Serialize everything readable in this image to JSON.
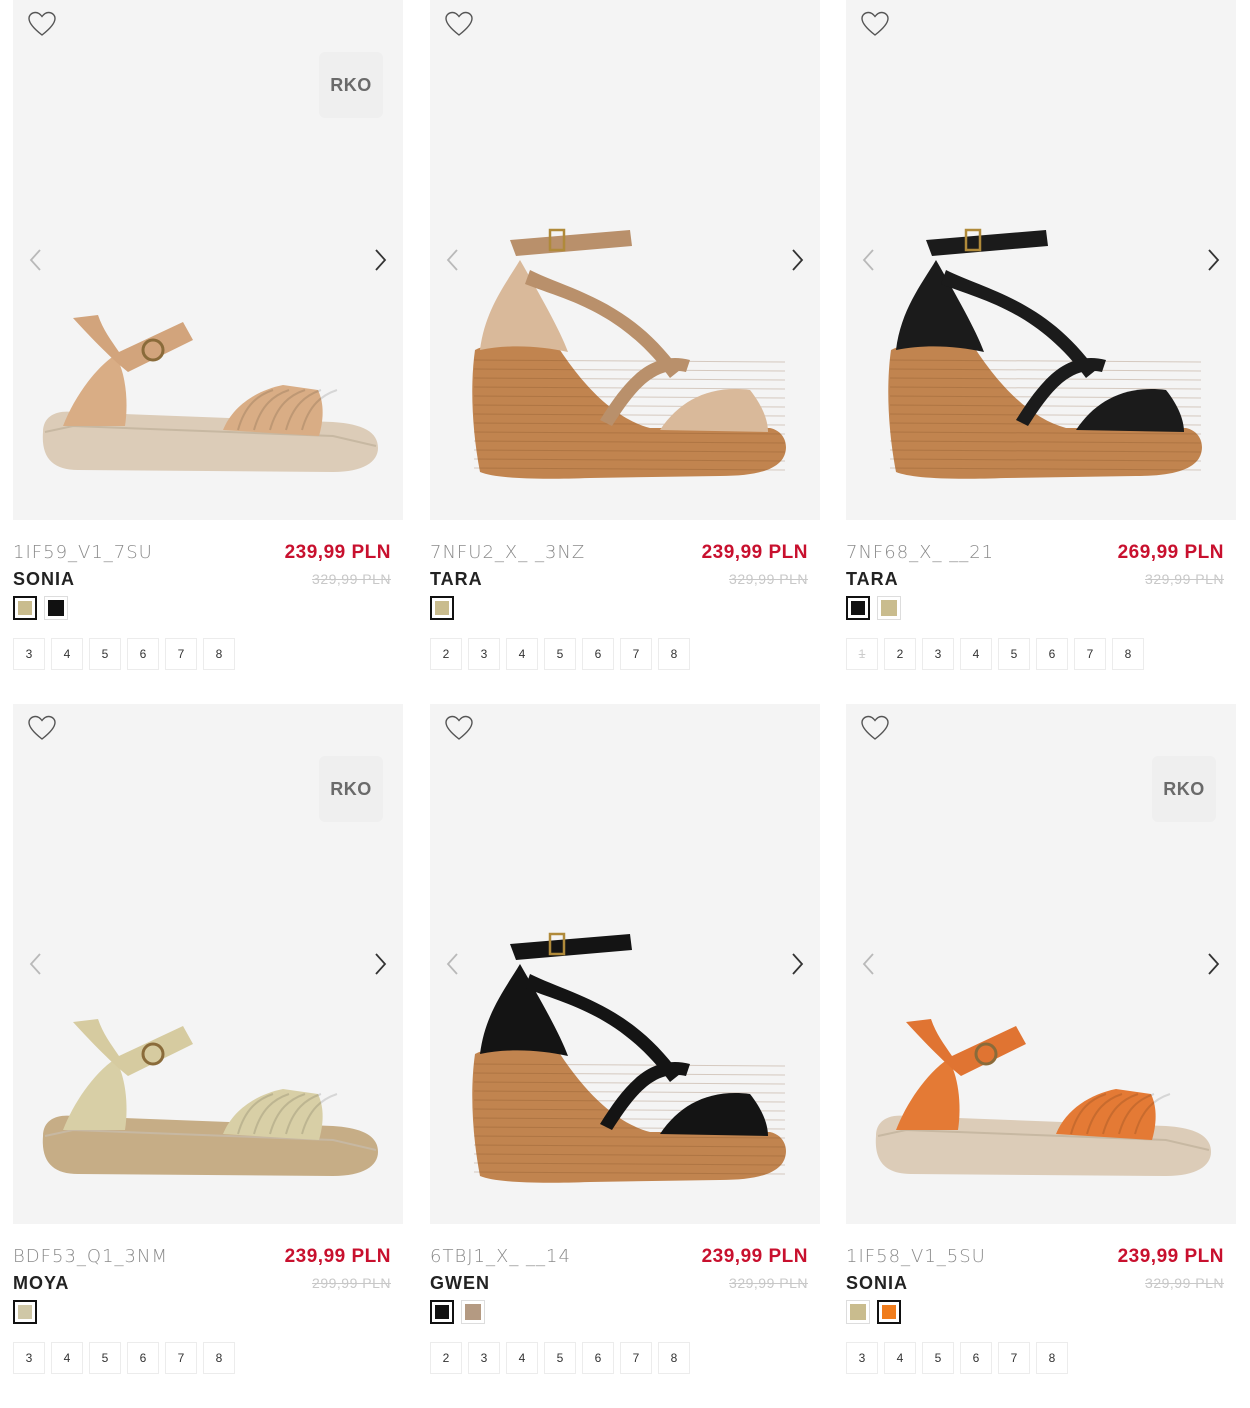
{
  "products": [
    {
      "code": "1IF59_V1_7SU",
      "name": "SONIA",
      "price": "239,99 PLN",
      "old_price": "329,99 PLN",
      "badge": "RKO",
      "shoe": {
        "type": "flat",
        "upper": "#d9ad85",
        "sole": "#dcccb8",
        "strap": "#d2a47c"
      },
      "colors": [
        {
          "hex": "#c9bc8e",
          "selected": true
        },
        {
          "hex": "#111111",
          "selected": false
        }
      ],
      "sizes": [
        {
          "label": "3"
        },
        {
          "label": "4"
        },
        {
          "label": "5"
        },
        {
          "label": "6"
        },
        {
          "label": "7"
        },
        {
          "label": "8"
        }
      ]
    },
    {
      "code": "7NFU2_X_ _3NZ",
      "name": "TARA",
      "price": "239,99 PLN",
      "old_price": "329,99 PLN",
      "badge": "",
      "shoe": {
        "type": "wedge",
        "upper": "#d9b99a",
        "sole": "#c1844f",
        "strap": "#b9906b"
      },
      "colors": [
        {
          "hex": "#c9bc8e",
          "selected": true
        }
      ],
      "sizes": [
        {
          "label": "2"
        },
        {
          "label": "3"
        },
        {
          "label": "4"
        },
        {
          "label": "5"
        },
        {
          "label": "6"
        },
        {
          "label": "7"
        },
        {
          "label": "8"
        }
      ]
    },
    {
      "code": "7NF68_X_ __21",
      "name": "TARA",
      "price": "269,99 PLN",
      "old_price": "329,99 PLN",
      "badge": "",
      "shoe": {
        "type": "wedge",
        "upper": "#1b1b1b",
        "sole": "#c1844f",
        "strap": "#1b1b1b"
      },
      "colors": [
        {
          "hex": "#111111",
          "selected": true
        },
        {
          "hex": "#c9bc8e",
          "selected": false
        }
      ],
      "sizes": [
        {
          "label": "1",
          "disabled": true
        },
        {
          "label": "2"
        },
        {
          "label": "3"
        },
        {
          "label": "4"
        },
        {
          "label": "5"
        },
        {
          "label": "6"
        },
        {
          "label": "7"
        },
        {
          "label": "8"
        }
      ]
    },
    {
      "code": "BDF53_Q1_3NM",
      "name": "MOYA",
      "price": "239,99 PLN",
      "old_price": "299,99 PLN",
      "badge": "RKO",
      "shoe": {
        "type": "flat",
        "upper": "#d8cfa6",
        "sole": "#c6ad86",
        "strap": "#d6cba0"
      },
      "colors": [
        {
          "hex": "#cfc7a6",
          "selected": true
        }
      ],
      "sizes": [
        {
          "label": "3"
        },
        {
          "label": "4"
        },
        {
          "label": "5"
        },
        {
          "label": "6"
        },
        {
          "label": "7"
        },
        {
          "label": "8"
        }
      ]
    },
    {
      "code": "6TBJ1_X_ __14",
      "name": "GWEN",
      "price": "239,99 PLN",
      "old_price": "329,99 PLN",
      "badge": "",
      "shoe": {
        "type": "wedge",
        "upper": "#141414",
        "sole": "#c1844f",
        "strap": "#141414"
      },
      "colors": [
        {
          "hex": "#111111",
          "selected": true
        },
        {
          "hex": "#b49a82",
          "selected": false
        }
      ],
      "sizes": [
        {
          "label": "2"
        },
        {
          "label": "3"
        },
        {
          "label": "4"
        },
        {
          "label": "5"
        },
        {
          "label": "6"
        },
        {
          "label": "7"
        },
        {
          "label": "8"
        }
      ]
    },
    {
      "code": "1IF58_V1_5SU",
      "name": "SONIA",
      "price": "239,99 PLN",
      "old_price": "329,99 PLN",
      "badge": "RKO",
      "shoe": {
        "type": "flat",
        "upper": "#e47a35",
        "sole": "#dcccb8",
        "strap": "#e07432"
      },
      "colors": [
        {
          "hex": "#c9bc8e",
          "selected": false
        },
        {
          "hex": "#f07c1c",
          "selected": true
        }
      ],
      "sizes": [
        {
          "label": "3"
        },
        {
          "label": "4"
        },
        {
          "label": "5"
        },
        {
          "label": "6"
        },
        {
          "label": "7"
        },
        {
          "label": "8"
        }
      ]
    }
  ]
}
